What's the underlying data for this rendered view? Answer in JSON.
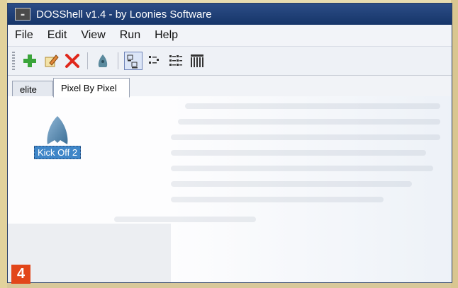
{
  "window": {
    "title": "DOSShell v1.4 - by Loonies Software"
  },
  "menu": {
    "file": "File",
    "edit": "Edit",
    "view": "View",
    "run": "Run",
    "help": "Help"
  },
  "toolbar": {
    "icons": [
      "add-icon",
      "edit-icon",
      "delete-icon",
      "run-icon",
      "large-icons-view-icon",
      "small-icons-view-icon",
      "list-view-icon",
      "details-view-icon"
    ]
  },
  "tabs": [
    {
      "label": "elite",
      "active": false
    },
    {
      "label": "Pixel By Pixel",
      "active": true
    }
  ],
  "shortcut": {
    "label": "Kick Off 2"
  },
  "badge": {
    "number": "4"
  },
  "colors": {
    "titlebar": "#1d3b72",
    "selection": "#3f86c8",
    "badge": "#e2461a"
  }
}
